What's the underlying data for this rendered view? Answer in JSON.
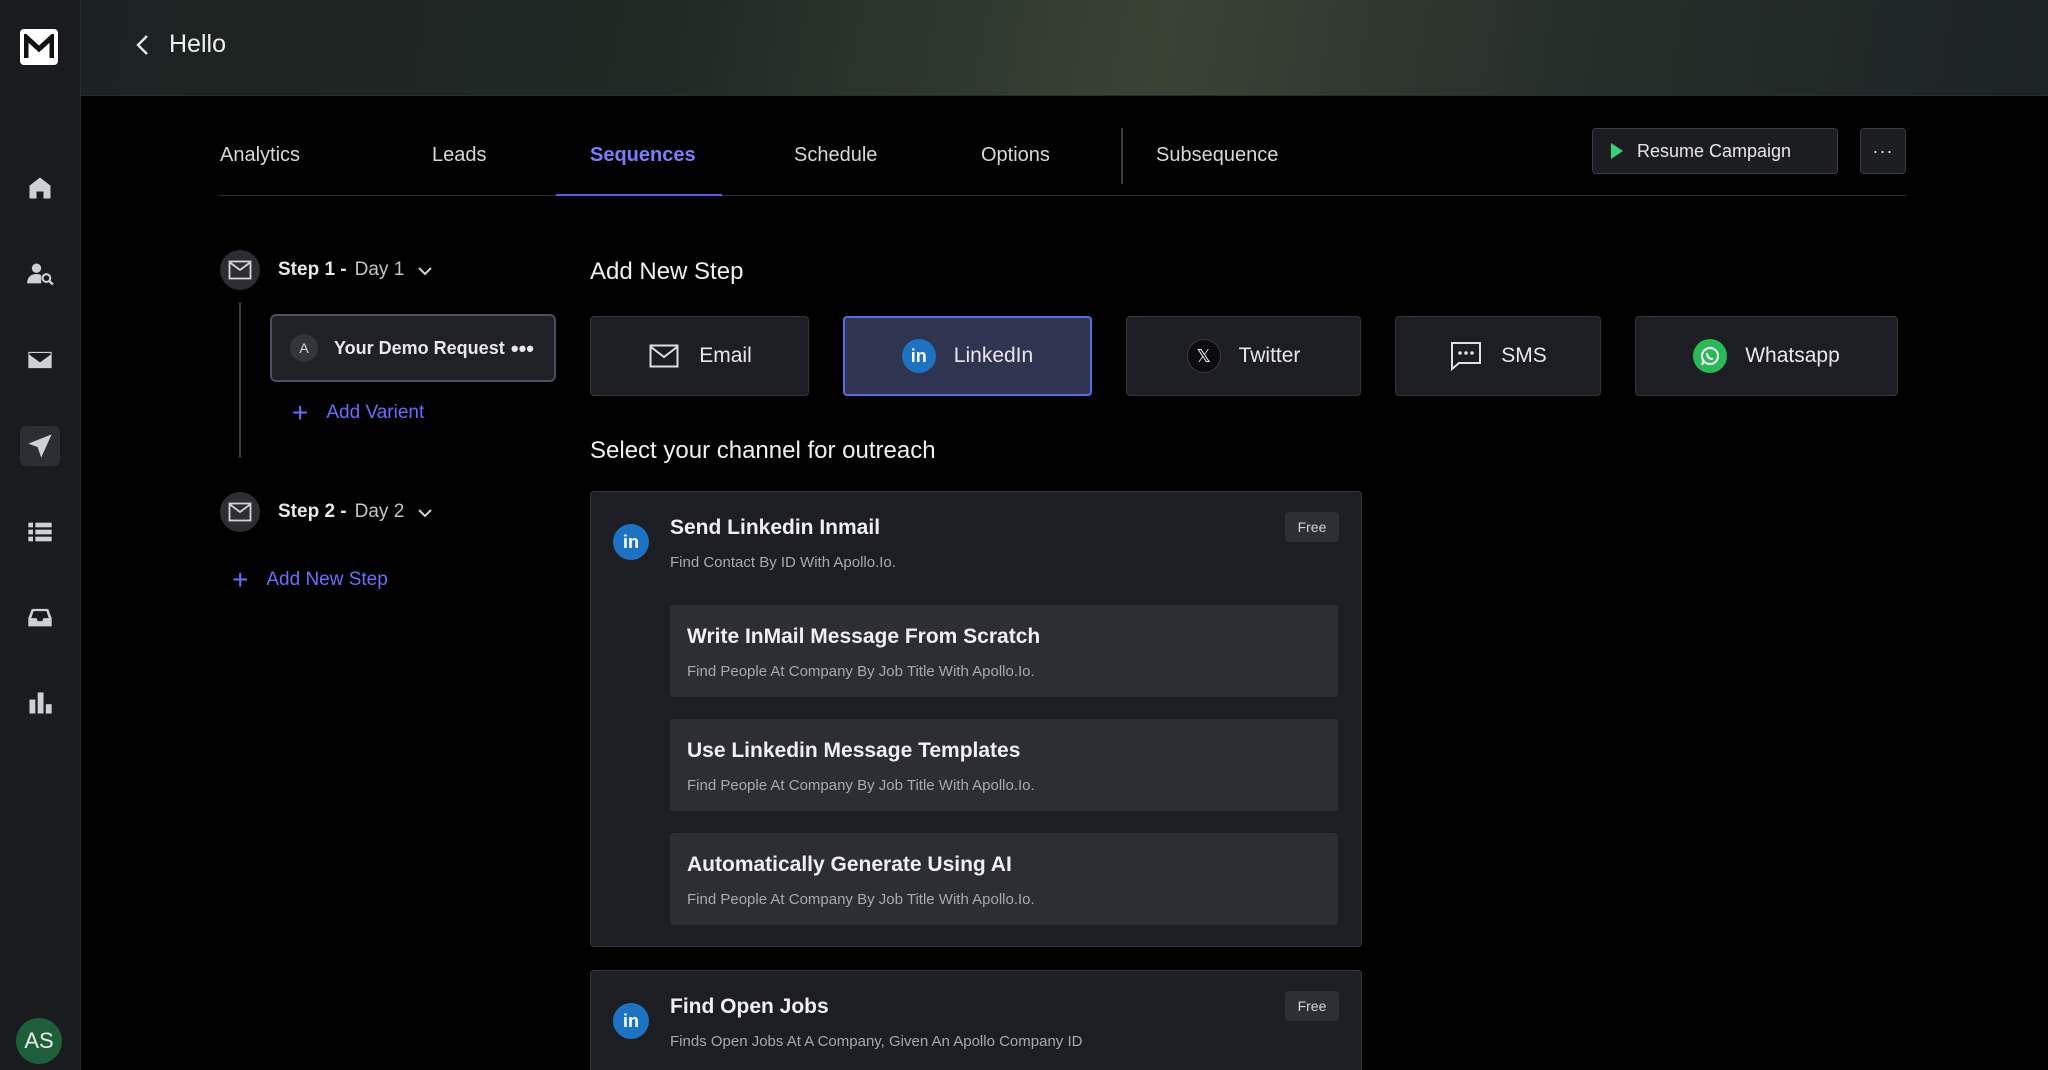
{
  "app": {
    "logo_letter": "M",
    "header_title": "Hello",
    "user_initials": "AS"
  },
  "sidebar": {
    "items": [
      {
        "icon": "home-icon"
      },
      {
        "icon": "leads-search-icon"
      },
      {
        "icon": "mail-icon"
      },
      {
        "icon": "send-icon",
        "active": true
      },
      {
        "icon": "list-icon"
      },
      {
        "icon": "inbox-icon"
      },
      {
        "icon": "bar-chart-icon"
      }
    ]
  },
  "tabs": [
    {
      "label": "Analytics"
    },
    {
      "label": "Leads"
    },
    {
      "label": "Sequences",
      "active": true
    },
    {
      "label": "Schedule"
    },
    {
      "label": "Options"
    },
    {
      "label": "Subsequence"
    }
  ],
  "actions": {
    "resume_label": "Resume Campaign",
    "more_label": "···"
  },
  "steps": [
    {
      "label": "Step 1 -",
      "day": "Day 1"
    },
    {
      "label": "Step 2 -",
      "day": "Day 2"
    }
  ],
  "variant": {
    "badge": "A",
    "title": "Your Demo Request",
    "menu": "•••"
  },
  "links": {
    "add_variant": "Add Varient",
    "add_step": "Add New Step"
  },
  "main": {
    "add_step_title": "Add New Step",
    "channels": [
      {
        "label": "Email",
        "icon": "mail-icon"
      },
      {
        "label": "LinkedIn",
        "icon": "linkedin-icon",
        "active": true
      },
      {
        "label": "Twitter",
        "icon": "x-icon"
      },
      {
        "label": "SMS",
        "icon": "sms-icon"
      },
      {
        "label": "Whatsapp",
        "icon": "whatsapp-icon"
      }
    ],
    "select_title": "Select your channel for outreach",
    "cards": [
      {
        "title": "Send Linkedin Inmail",
        "subtitle": "Find Contact By ID With Apollo.Io.",
        "badge": "Free",
        "options": [
          {
            "title": "Write InMail Message From Scratch",
            "subtitle": "Find People At Company By Job Title With Apollo.Io."
          },
          {
            "title": "Use Linkedin Message Templates",
            "subtitle": "Find People At Company By Job Title With Apollo.Io."
          },
          {
            "title": "Automatically Generate Using AI",
            "subtitle": "Find People At Company By Job Title With Apollo.Io."
          }
        ]
      },
      {
        "title": "Find Open Jobs",
        "subtitle": "Finds Open Jobs At A Company, Given An Apollo Company ID",
        "badge": "Free"
      }
    ]
  },
  "colors": {
    "accent": "#6c6cff",
    "linkedin": "#1e72c2",
    "whatsapp": "#29b957",
    "play": "#33d17a"
  }
}
